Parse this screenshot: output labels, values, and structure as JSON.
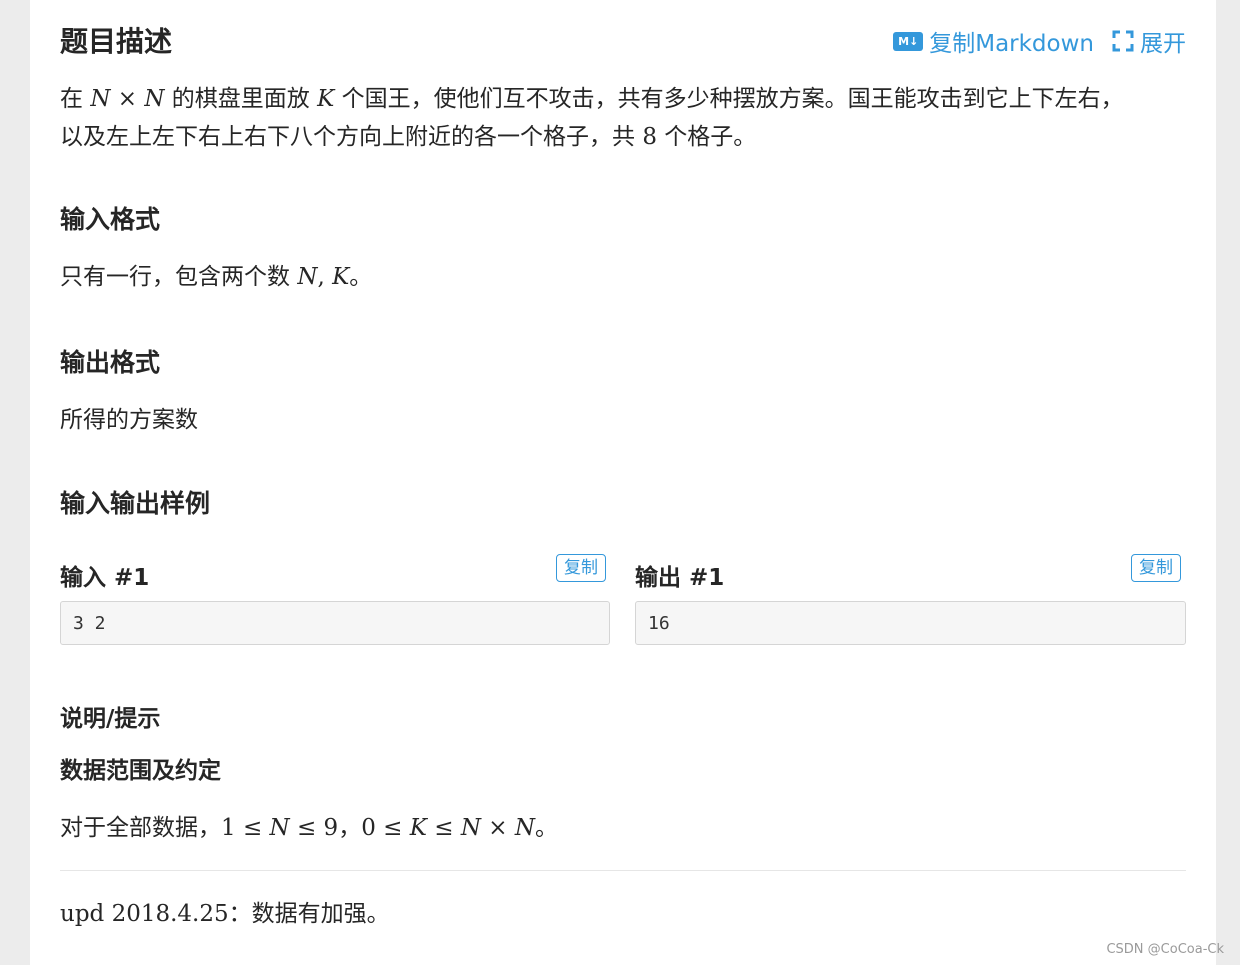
{
  "problem": {
    "title": "题目描述",
    "copy_markdown_label": "复制Markdown",
    "md_icon_text": "M↓",
    "expand_label": "展开",
    "desc_line1": {
      "t1": "在 ",
      "m1": "N",
      "op1": " × ",
      "m2": "N",
      "t2": " 的棋盘里面放 ",
      "m3": "K",
      "t3": " 个国王，使他们互不攻击，共有多少种摆放方案。国王能攻击到它上下左右，"
    },
    "desc_line2": {
      "t1": "以及左上左下右上右下八个方向上附近的各一个格子，共 ",
      "n1": "8",
      "t2": " 个格子。"
    }
  },
  "input_format": {
    "title": "输入格式",
    "text": {
      "t1": "只有一行，包含两个数 ",
      "m1": "N",
      "sep": ", ",
      "m2": "K",
      "t2": "。"
    }
  },
  "output_format": {
    "title": "输出格式",
    "text": "所得的方案数"
  },
  "samples": {
    "title": "输入输出样例",
    "input_label": "输入 #1",
    "output_label": "输出 #1",
    "copy_label": "复制",
    "input_value": "3 2",
    "output_value": "16"
  },
  "hint": {
    "title": "说明/提示",
    "subtitle": "数据范围及约定",
    "range": {
      "t1": "对于全部数据，",
      "a1": "1 ≤ ",
      "m1": "N",
      "a2": " ≤ 9",
      "t2": "，",
      "a3": "0 ≤ ",
      "m2": "K",
      "a4": " ≤ ",
      "m3": "N",
      "a5": " × ",
      "m4": "N",
      "t3": "。"
    },
    "upd": {
      "n1": "upd 2018.4.25",
      "t1": "：数据有加强。"
    }
  },
  "watermark": "CSDN @CoCoa-Ck",
  "colors": {
    "accent": "#3498db",
    "text": "#262626",
    "page_bg": "#ececec",
    "card_bg": "#ffffff"
  },
  "icons": {
    "markdown": "markdown-icon",
    "expand": "expand-icon"
  }
}
